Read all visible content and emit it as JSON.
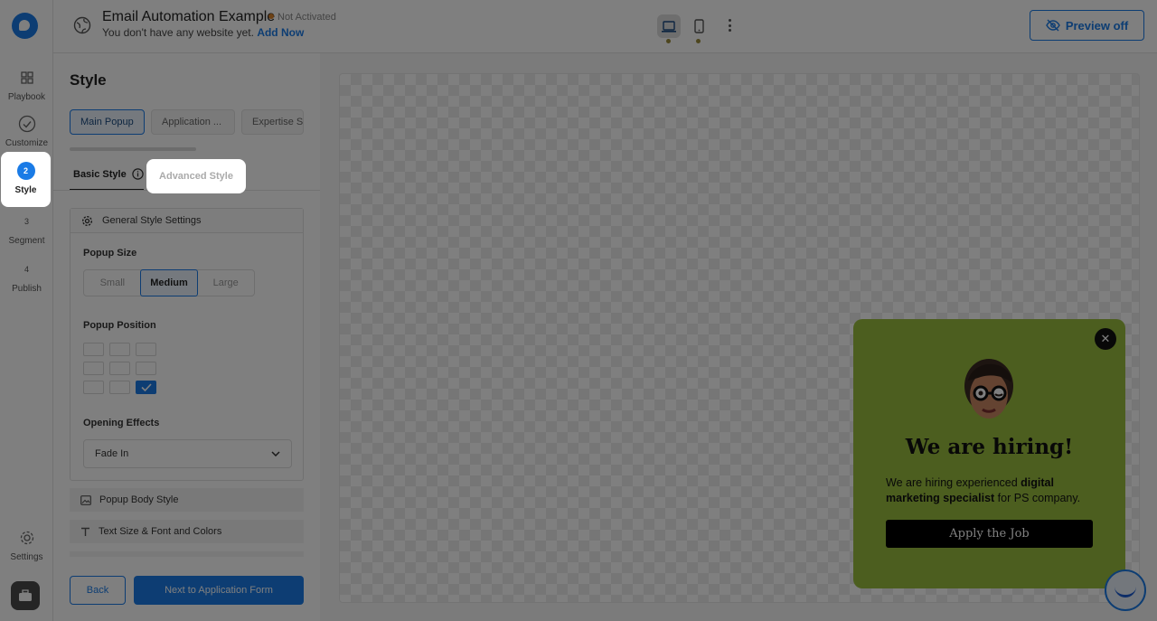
{
  "topbar": {
    "site_title": "Email Automation Example",
    "status": "Not Activated",
    "subtitle": "You don't have any website yet.",
    "add_now": "Add Now",
    "preview_label": "Preview off"
  },
  "rail": {
    "items": [
      {
        "label": "Playbook",
        "icon": "grid-icon"
      },
      {
        "label": "Customize",
        "icon": "check-circle-icon"
      },
      {
        "label": "Style",
        "number": "2",
        "active": true
      },
      {
        "label": "Segment",
        "number": "3"
      },
      {
        "label": "Publish",
        "number": "4"
      }
    ],
    "settings_label": "Settings"
  },
  "panel": {
    "title": "Style",
    "popup_tabs": [
      "Main Popup",
      "Application ...",
      "Expertise S"
    ],
    "subtabs": {
      "basic": "Basic Style",
      "advanced": "Advanced Style"
    },
    "general": {
      "header": "General Style Settings",
      "size_label": "Popup Size",
      "sizes": [
        "Small",
        "Medium",
        "Large"
      ],
      "selected_size": "Medium",
      "position_label": "Popup Position",
      "effects_label": "Opening Effects",
      "effect_value": "Fade In"
    },
    "accordions": [
      "Popup Body Style",
      "Text Size & Font and Colors"
    ],
    "back_label": "Back",
    "next_label": "Next to Application Form"
  },
  "popup": {
    "title": "We are hiring!",
    "body_prefix": "We are hiring experienced ",
    "body_bold": "digital marketing specialist",
    "body_suffix": " for PS company.",
    "button": "Apply the Job",
    "close": "✕",
    "bg_color": "#98bc3f"
  },
  "colors": {
    "accent": "#1a7be6",
    "overlay": "rgba(0,0,0,0.5)"
  }
}
